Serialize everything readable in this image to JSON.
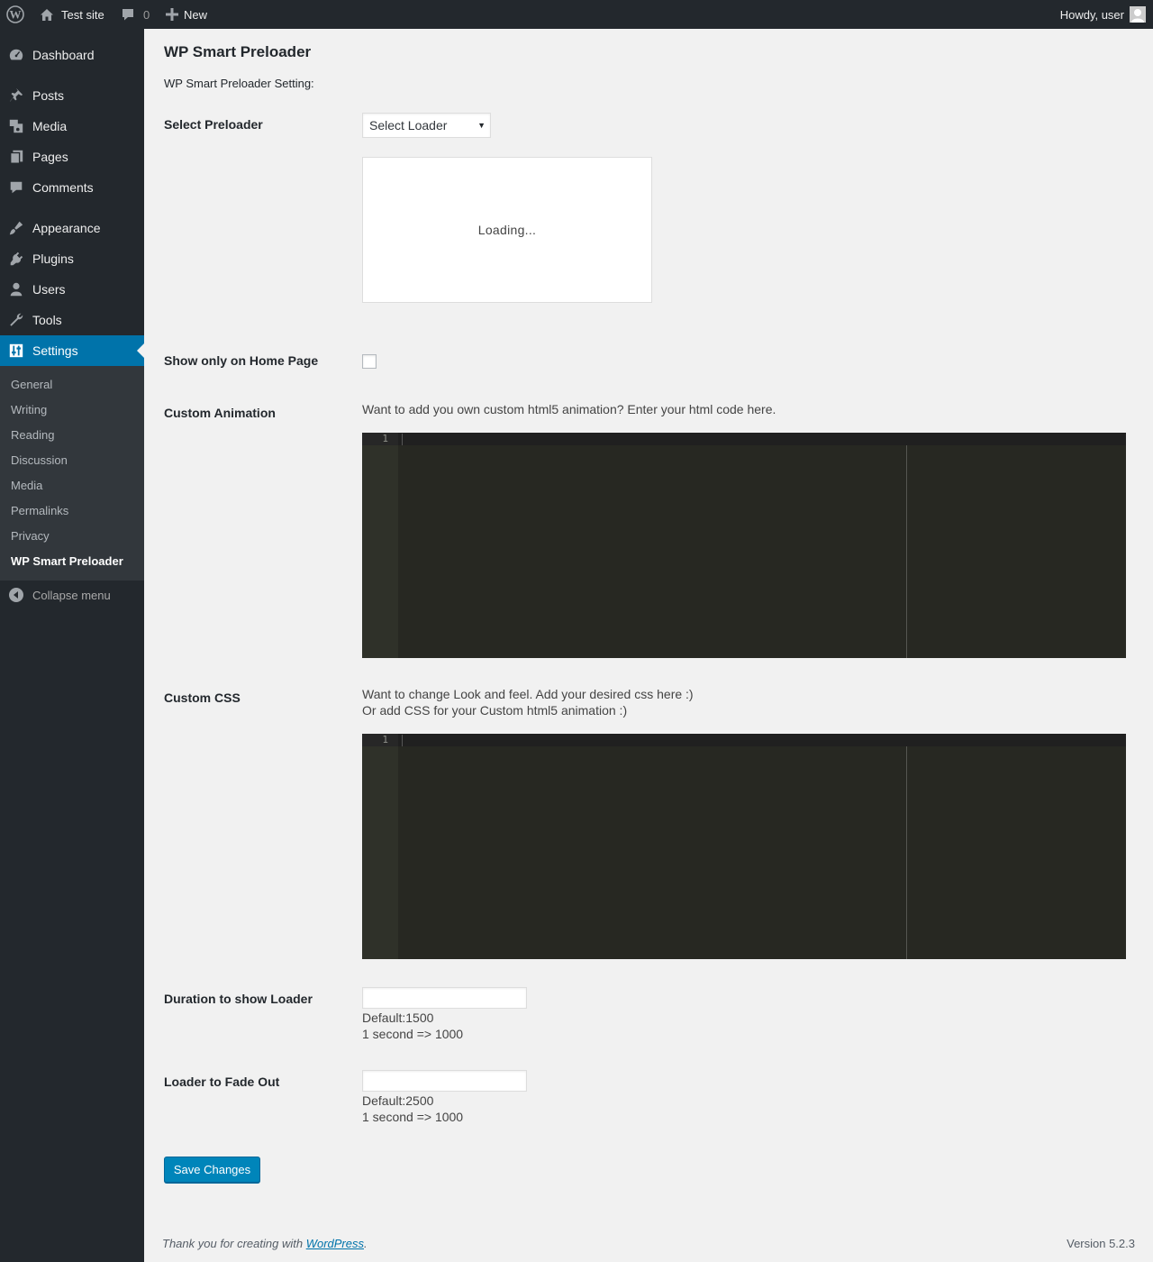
{
  "admin_bar": {
    "site_name": "Test site",
    "comments_count": "0",
    "new_label": "New",
    "howdy": "Howdy, user"
  },
  "sidebar": {
    "items": [
      {
        "label": "Dashboard",
        "icon": "dashboard-icon"
      },
      {
        "label": "Posts",
        "icon": "pushpin-icon"
      },
      {
        "label": "Media",
        "icon": "media-icon"
      },
      {
        "label": "Pages",
        "icon": "pages-icon"
      },
      {
        "label": "Comments",
        "icon": "comment-icon"
      },
      {
        "label": "Appearance",
        "icon": "paintbrush-icon"
      },
      {
        "label": "Plugins",
        "icon": "plug-icon"
      },
      {
        "label": "Users",
        "icon": "user-icon"
      },
      {
        "label": "Tools",
        "icon": "wrench-icon"
      },
      {
        "label": "Settings",
        "icon": "settings-sliders-icon"
      }
    ],
    "submenu": [
      "General",
      "Writing",
      "Reading",
      "Discussion",
      "Media",
      "Permalinks",
      "Privacy",
      "WP Smart Preloader"
    ],
    "collapse_label": "Collapse menu"
  },
  "page": {
    "title": "WP Smart Preloader",
    "subtitle": "WP Smart Preloader Setting:",
    "select_preloader": {
      "label": "Select Preloader",
      "value": "Select Loader",
      "preview_text": "Loading..."
    },
    "home_only": {
      "label": "Show only on Home Page",
      "checked": false
    },
    "custom_animation": {
      "label": "Custom Animation",
      "description": "Want to add you own custom html5 animation? Enter your html code here.",
      "line_number": "1"
    },
    "custom_css": {
      "label": "Custom CSS",
      "description_line1": "Want to change Look and feel. Add your desired css here :)",
      "description_line2": "Or add CSS for your Custom html5 animation :)",
      "line_number": "1"
    },
    "duration": {
      "label": "Duration to show Loader",
      "value": "",
      "hint_default": "Default:1500",
      "hint_unit": "1 second => 1000"
    },
    "fade_out": {
      "label": "Loader to Fade Out",
      "value": "",
      "hint_default": "Default:2500",
      "hint_unit": "1 second => 1000"
    },
    "save_label": "Save Changes"
  },
  "footer": {
    "thanks_prefix": "Thank you for creating with ",
    "thanks_link": "WordPress",
    "thanks_suffix": ".",
    "version": "Version 5.2.3"
  },
  "colors": {
    "admin_bar": "#23282d",
    "sidebar": "#23282d",
    "submenu": "#32373c",
    "accent": "#0073aa",
    "button": "#0085ba",
    "editor_bg": "#272822"
  }
}
